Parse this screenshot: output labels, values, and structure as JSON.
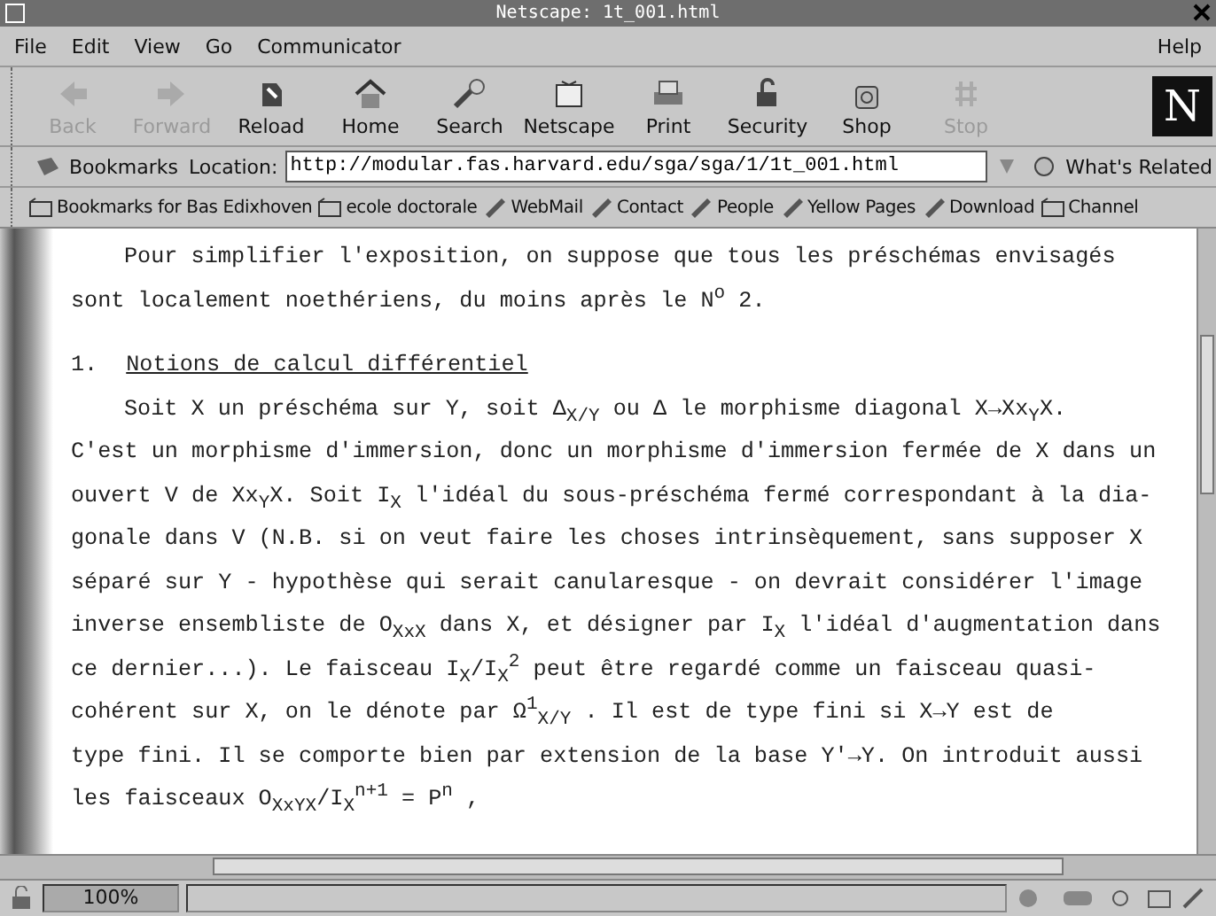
{
  "window": {
    "title": "Netscape: 1t_001.html"
  },
  "menu": {
    "left": [
      "File",
      "Edit",
      "View",
      "Go",
      "Communicator"
    ],
    "right": "Help"
  },
  "toolbar": [
    {
      "kind": "back",
      "label": "Back",
      "disabled": true
    },
    {
      "kind": "forward",
      "label": "Forward",
      "disabled": true
    },
    {
      "kind": "reload",
      "label": "Reload",
      "disabled": false
    },
    {
      "kind": "home",
      "label": "Home",
      "disabled": false
    },
    {
      "kind": "search",
      "label": "Search",
      "disabled": false
    },
    {
      "kind": "netscape",
      "label": "Netscape",
      "disabled": false
    },
    {
      "kind": "print",
      "label": "Print",
      "disabled": false
    },
    {
      "kind": "security",
      "label": "Security",
      "disabled": false
    },
    {
      "kind": "shop",
      "label": "Shop",
      "disabled": false
    },
    {
      "kind": "stop",
      "label": "Stop",
      "disabled": true
    }
  ],
  "logo": "N",
  "location_bar": {
    "bookmarks": "Bookmarks",
    "label": "Location:",
    "url": "http://modular.fas.harvard.edu/sga/sga/1/1t_001.html",
    "related": "What's Related"
  },
  "personal_toolbar": [
    {
      "kind": "folder",
      "label": "Bookmarks for Bas Edixhoven"
    },
    {
      "kind": "folder",
      "label": "ecole doctorale"
    },
    {
      "kind": "link",
      "label": "WebMail"
    },
    {
      "kind": "link",
      "label": "Contact"
    },
    {
      "kind": "link",
      "label": "People"
    },
    {
      "kind": "link",
      "label": "Yellow Pages"
    },
    {
      "kind": "link",
      "label": "Download"
    },
    {
      "kind": "folder",
      "label": "Channel"
    }
  ],
  "document": [
    {
      "kind": "indent",
      "text": "Pour simplifier l'exposition, on suppose que tous les préschémas envisagés"
    },
    {
      "kind": "line",
      "text": "sont localement noethériens, du moins après le N$^{o}$ 2."
    },
    {
      "kind": "gap"
    },
    {
      "kind": "heading",
      "number": "1.",
      "text": "Notions de calcul différentiel"
    },
    {
      "kind": "indent",
      "text": "Soit X un préschéma sur Y,  soit Δ$_{X/Y}$ ou Δ le morphisme diagonal X→Xx$_{Y}$X."
    },
    {
      "kind": "line",
      "text": "C'est un morphisme d'immersion, donc un morphisme d'immersion fermée de X dans un"
    },
    {
      "kind": "line",
      "text": "ouvert V de Xx$_{Y}$X.  Soit I$_{X}$ l'idéal du sous-préschéma fermé correspondant à la dia-"
    },
    {
      "kind": "line",
      "text": "gonale dans V (N.B. si on veut faire les choses intrinsèquement, sans supposer X"
    },
    {
      "kind": "line",
      "text": "séparé sur Y - hypothèse qui serait canularesque - on devrait considérer l'image"
    },
    {
      "kind": "line",
      "text": "inverse ensembliste de O$_{XxX}$  dans X, et désigner par I$_{X}$ l'idéal d'augmentation dans"
    },
    {
      "kind": "line",
      "text": "ce dernier...). Le faisceau I$_{X}$/I$_{X}$$^{2}$  peut être regardé comme un faisceau quasi-"
    },
    {
      "kind": "line",
      "text": "cohérent sur X, on le dénote par Ω$^{1}$$_{X/Y}$ .  Il est de type fini si  X→Y  est de"
    },
    {
      "kind": "line",
      "text": "type fini. Il se comporte bien par extension de la base Y'→Y.  On introduit aussi"
    },
    {
      "kind": "line",
      "text": "les faisceaux O$_{XxYX}$/I$_{X}$$^{n+1}$  =  P$^{n}$ ,"
    }
  ],
  "status_bar": {
    "zoom": "100%"
  }
}
